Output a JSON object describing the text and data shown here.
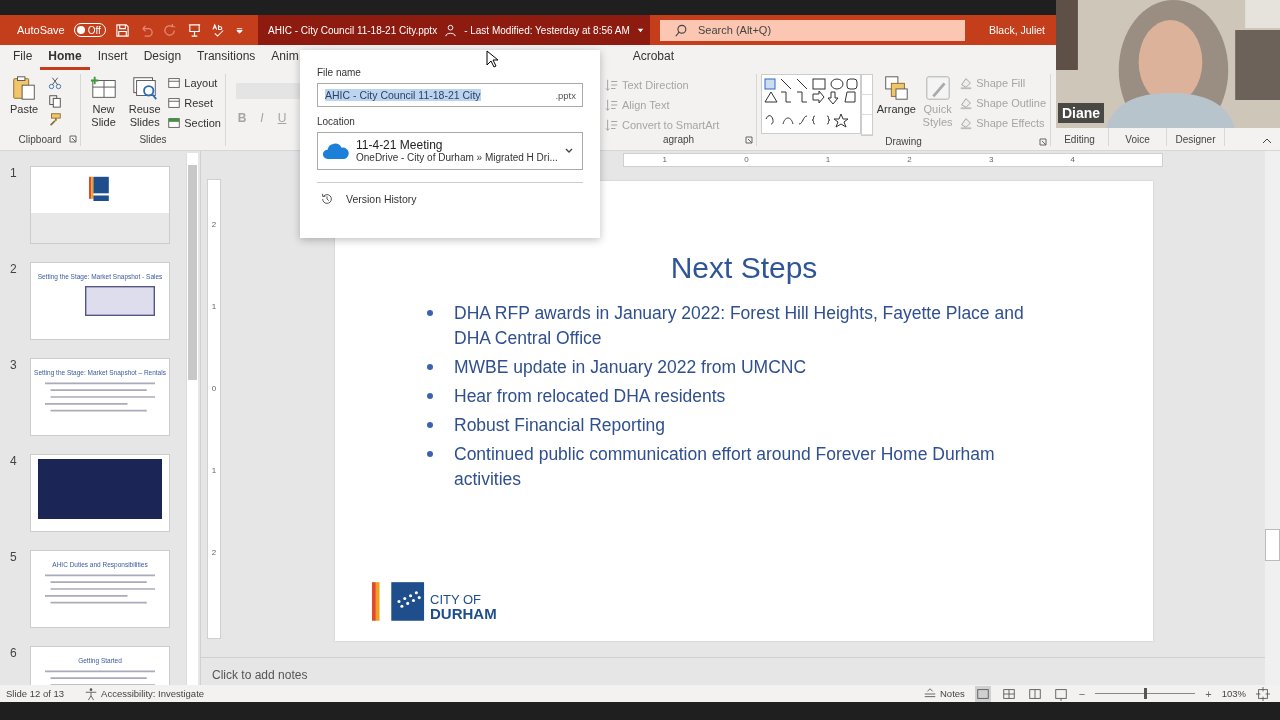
{
  "title_bar": {
    "autosave_label": "AutoSave",
    "autosave_toggle": {
      "label": "Off",
      "on": false
    },
    "document_title": "AHIC - City Council 11-18-21 City.pptx",
    "last_modified": "- Last Modified: Yesterday at 8:56 AM",
    "search": {
      "placeholder": "Search (Alt+Q)"
    },
    "user": "Black, Juliet"
  },
  "ribbon_tabs": [
    {
      "label": "File",
      "selected": false
    },
    {
      "label": "Home",
      "selected": true
    },
    {
      "label": "Insert",
      "selected": false
    },
    {
      "label": "Design",
      "selected": false
    },
    {
      "label": "Transitions",
      "selected": false
    },
    {
      "label": "Anim",
      "selected": false
    }
  ],
  "ribbon_tabs_right": [
    {
      "label": "Acrobat",
      "selected": false
    }
  ],
  "ribbon": {
    "clipboard": {
      "label": "Clipboard",
      "paste": "Paste"
    },
    "slides": {
      "label": "Slides",
      "new_slide": "New Slide",
      "reuse_slides": "Reuse Slides",
      "small_buttons": [
        "Layout",
        "Reset",
        "Section"
      ]
    },
    "font": {
      "buttons": [
        {
          "label": "B",
          "disabled": true
        },
        {
          "label": "I",
          "disabled": true
        },
        {
          "label": "U",
          "disabled": true
        }
      ]
    },
    "paragraph": {
      "label": "agraph",
      "buttons": [
        {
          "label": "Text Direction",
          "disabled": true
        },
        {
          "label": "Align Text",
          "disabled": true
        },
        {
          "label": "Convert to SmartArt",
          "disabled": true
        }
      ]
    },
    "drawing": {
      "label": "Drawing",
      "arrange": "Arrange",
      "quick_styles": {
        "label": "Quick Styles",
        "disabled": true
      },
      "shape_buttons": [
        {
          "label": "Shape Fill",
          "disabled": true
        },
        {
          "label": "Shape Outline",
          "disabled": true
        },
        {
          "label": "Shape Effects",
          "disabled": true
        }
      ]
    },
    "collapsed_groups": [
      "Editing",
      "Voice",
      "Designer"
    ]
  },
  "video": {
    "name": "Diane"
  },
  "file_popup": {
    "file_name_label": "File name",
    "file_name": "AHIC - City Council 11-18-21 City",
    "extension": ".pptx",
    "location_label": "Location",
    "location_name": "11-4-21 Meeting",
    "location_path": "OneDrive - City of Durham » Migrated H Dri...",
    "version_history": "Version History"
  },
  "thumbnails": [
    {
      "number": "1",
      "kind": "title",
      "selected": false
    },
    {
      "number": "2",
      "kind": "table",
      "title": "Setting the Stage: Market Snapshot - Sales",
      "selected": false
    },
    {
      "number": "3",
      "kind": "bullets",
      "title": "Setting the Stage: Market Snapshot – Rentals",
      "selected": false
    },
    {
      "number": "4",
      "kind": "dark",
      "selected": false
    },
    {
      "number": "5",
      "kind": "bullets",
      "title": "AHIC Duties and Responsibilities",
      "selected": false
    },
    {
      "number": "6",
      "kind": "bullets",
      "title": "Getting Started",
      "selected": false
    }
  ],
  "rulers": {
    "horizontal": [
      "1",
      "0",
      "1",
      "2",
      "3",
      "4"
    ],
    "vertical": [
      "2",
      "1",
      "0",
      "1",
      "2"
    ]
  },
  "slide": {
    "title": "Next Steps",
    "bullets": [
      "DHA RFP awards in January 2022: Forest Hill Heights, Fayette Place and DHA Central Office",
      "MWBE update in January 2022 from UMCNC",
      "Hear from relocated DHA residents",
      "Robust Financial Reporting",
      "Continued public communication effort around Forever Home Durham activities"
    ],
    "logo": [
      "CITY OF",
      "DURHAM"
    ]
  },
  "notes_placeholder": "Click to add notes",
  "status_bar": {
    "slide_position": "Slide 12 of 13",
    "accessibility": "Accessibility: Investigate",
    "notes": "Notes",
    "views": [
      {
        "selected": true
      },
      {
        "selected": false
      },
      {
        "selected": false
      },
      {
        "selected": false
      }
    ],
    "zoom": {
      "minus": "−",
      "level": 0.5,
      "plus": "+",
      "reading": "103%"
    }
  }
}
